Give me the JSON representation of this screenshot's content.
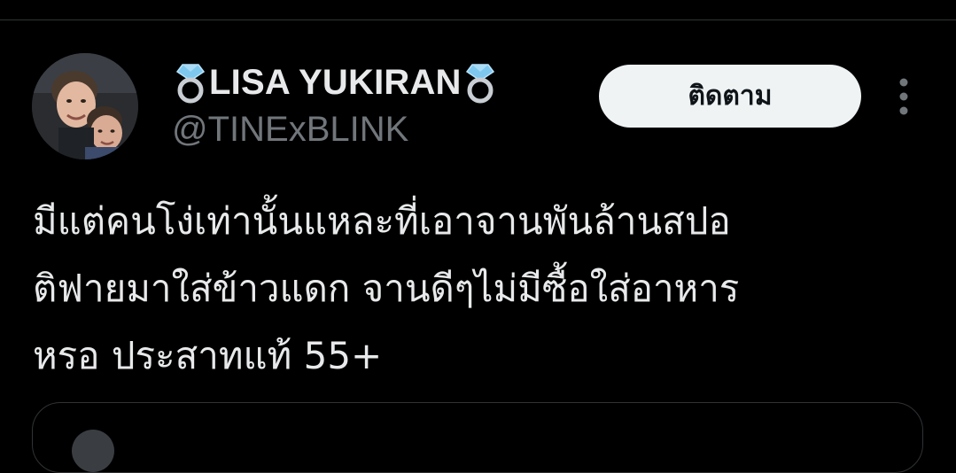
{
  "tweet": {
    "author": {
      "display_name": "LISA YUKIRAN",
      "handle": "@TINExBLINK",
      "name_decoration_icon": "ring-icon",
      "avatar_icon": "avatar"
    },
    "follow_label": "ติดตาม",
    "more_icon": "more-options-icon",
    "text_lines": [
      "มีแต่คนโง่เท่านั้นแหละที่เอาจานพันล้านสปอ",
      "ติฟายมาใส่ข้าวแดก จานดีๆไม่มีซื้อใส่อาหาร",
      "หรอ ประสาทแท้ 55+"
    ]
  },
  "colors": {
    "background": "#000000",
    "text_primary": "#e7e9ea",
    "text_secondary": "#71767b",
    "follow_button_bg": "#eff3f4",
    "follow_button_text": "#0f1419",
    "divider": "#2f3336",
    "ring_gem": "#7ec8f0"
  }
}
